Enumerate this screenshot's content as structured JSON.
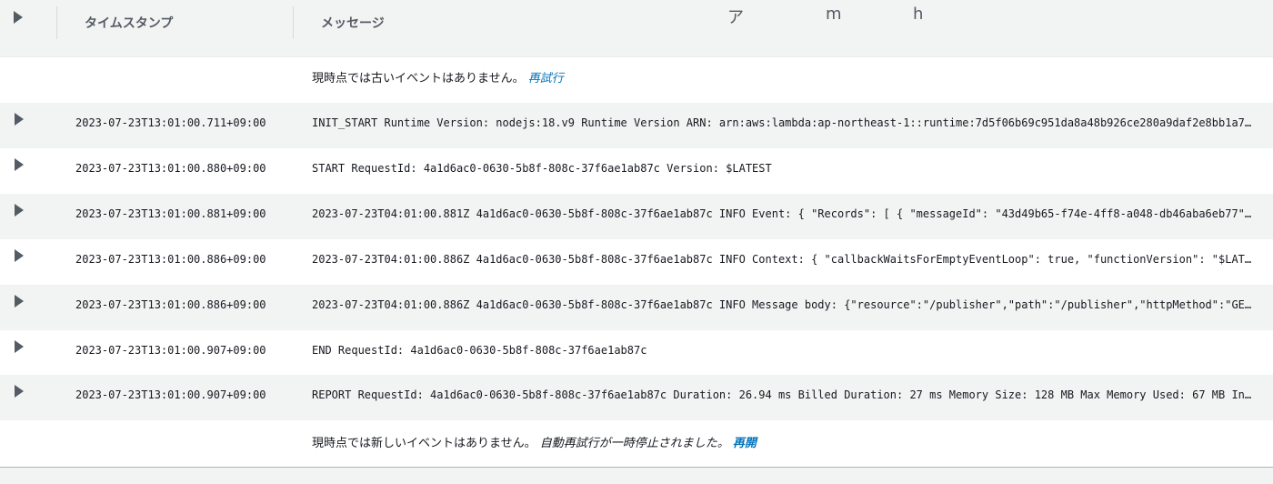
{
  "header": {
    "timestamp_col": "タイムスタンプ",
    "message_col": "メッセージ",
    "floating_chars": [
      "ア",
      "m",
      "h"
    ]
  },
  "older_notice": {
    "text": "現時点では古いイベントはありません。",
    "retry_link": "再試行"
  },
  "events": [
    {
      "timestamp": "2023-07-23T13:01:00.711+09:00",
      "message": "INIT_START Runtime Version: nodejs:18.v9 Runtime Version ARN: arn:aws:lambda:ap-northeast-1::runtime:7d5f06b69c951da8a48b926ce280a9daf2e8bb1a74…"
    },
    {
      "timestamp": "2023-07-23T13:01:00.880+09:00",
      "message": "START RequestId: 4a1d6ac0-0630-5b8f-808c-37f6ae1ab87c Version: $LATEST"
    },
    {
      "timestamp": "2023-07-23T13:01:00.881+09:00",
      "message": "2023-07-23T04:01:00.881Z 4a1d6ac0-0630-5b8f-808c-37f6ae1ab87c INFO Event: { \"Records\": [ { \"messageId\": \"43d49b65-f74e-4ff8-a048-db46aba6eb77\",…"
    },
    {
      "timestamp": "2023-07-23T13:01:00.886+09:00",
      "message": "2023-07-23T04:01:00.886Z 4a1d6ac0-0630-5b8f-808c-37f6ae1ab87c INFO Context: { \"callbackWaitsForEmptyEventLoop\": true, \"functionVersion\": \"$LATE…"
    },
    {
      "timestamp": "2023-07-23T13:01:00.886+09:00",
      "message": "2023-07-23T04:01:00.886Z 4a1d6ac0-0630-5b8f-808c-37f6ae1ab87c INFO Message body: {\"resource\":\"/publisher\",\"path\":\"/publisher\",\"httpMethod\":\"GET…"
    },
    {
      "timestamp": "2023-07-23T13:01:00.907+09:00",
      "message": "END RequestId: 4a1d6ac0-0630-5b8f-808c-37f6ae1ab87c"
    },
    {
      "timestamp": "2023-07-23T13:01:00.907+09:00",
      "message": "REPORT RequestId: 4a1d6ac0-0630-5b8f-808c-37f6ae1ab87c Duration: 26.94 ms Billed Duration: 27 ms Memory Size: 128 MB Max Memory Used: 67 MB Ini…"
    }
  ],
  "newer_notice": {
    "text": "現時点では新しいイベントはありません。",
    "paused_text": "自動再試行が一時停止されました。",
    "resume_link": "再開"
  },
  "colors": {
    "link": "#0073bb",
    "header_bg": "#f2f3f3",
    "row_alt_bg": "#f2f3f3",
    "row_bg": "#ffffff"
  },
  "icons": {
    "expand": "triangle-right-icon"
  }
}
